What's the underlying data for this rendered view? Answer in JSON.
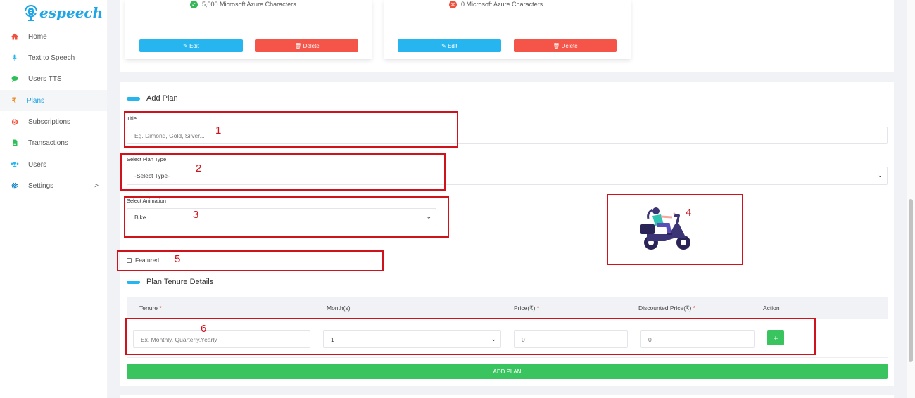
{
  "app": {
    "logo_text": "espeech"
  },
  "sidebar": {
    "items": [
      {
        "label": "Home",
        "icon": "home-icon",
        "active": false
      },
      {
        "label": "Text to Speech",
        "icon": "microphone-icon",
        "active": false
      },
      {
        "label": "Users TTS",
        "icon": "chat-icon",
        "active": false
      },
      {
        "label": "Plans",
        "icon": "rupee-icon",
        "active": true
      },
      {
        "label": "Subscriptions",
        "icon": "power-icon",
        "active": false
      },
      {
        "label": "Transactions",
        "icon": "file-icon",
        "active": false
      },
      {
        "label": "Users",
        "icon": "users-icon",
        "active": false
      },
      {
        "label": "Settings",
        "icon": "gear-icon",
        "active": false,
        "chevron": ">"
      }
    ]
  },
  "plan_cards": [
    {
      "feature_value": "5,000",
      "feature_text": "Microsoft Azure Characters",
      "status": "included",
      "edit_label": "Edit",
      "delete_label": "Delete"
    },
    {
      "feature_value": "0",
      "feature_text": "Microsoft Azure Characters",
      "status": "excluded",
      "edit_label": "Edit",
      "delete_label": "Delete"
    }
  ],
  "add_plan": {
    "heading": "Add Plan",
    "title_label": "Title",
    "title_placeholder": "Eg. Dimond, Gold, Silver...",
    "plan_type_label": "Select Plan Type",
    "plan_type_value": "-Select Type-",
    "animation_label": "Select Animation",
    "animation_value": "Bike",
    "featured_label": "Featured",
    "featured_checked": false
  },
  "tenure": {
    "heading": "Plan Tenure Details",
    "columns": [
      {
        "label": "Tenure",
        "required": true
      },
      {
        "label": "Month(s)",
        "required": false
      },
      {
        "label": "Price(₹)",
        "required": true
      },
      {
        "label": "Discounted Price(₹)",
        "required": true
      },
      {
        "label": "Action",
        "required": false
      }
    ],
    "row": {
      "tenure_placeholder": "Ex. Monthly, Quarterly,Yearly",
      "months_value": "1",
      "price_value": "0",
      "discounted_value": "0",
      "add_symbol": "+"
    },
    "submit_label": "ADD PLAN"
  },
  "annotations": [
    "1",
    "2",
    "3",
    "4",
    "5",
    "6"
  ],
  "colors": {
    "accent": "#27b5ef",
    "danger": "#f55448",
    "success": "#3ac460",
    "annotation": "#d0121c"
  }
}
